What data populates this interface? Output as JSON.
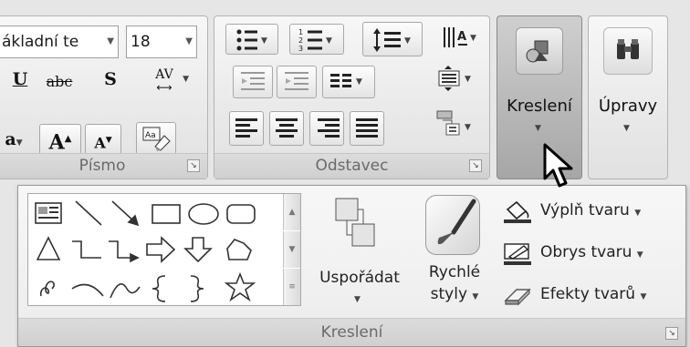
{
  "font_group": {
    "font_name": "ákladní te",
    "font_size": "18",
    "label": "Písmo",
    "underline": "U",
    "strike": "abc",
    "shadow": "S",
    "spacing": "AV",
    "grow": "A",
    "shrink": "A",
    "partial_a": "a"
  },
  "paragraph_group": {
    "label": "Odstavec"
  },
  "drawing_group": {
    "label": "Kreslení"
  },
  "editing_group": {
    "label": "Úpravy"
  },
  "drawing_panel": {
    "arrange": "Uspořádat",
    "quick_styles_line1": "Rychlé",
    "quick_styles_line2": "styly",
    "shape_fill": "Výplň tvaru",
    "shape_outline": "Obrys tvaru",
    "shape_effects": "Efekty tvarů",
    "label": "Kreslení"
  },
  "icons": [
    "bullets-icon",
    "numbering-icon",
    "line-spacing-icon",
    "text-direction-icon",
    "decrease-indent-icon",
    "increase-indent-icon",
    "columns-icon",
    "align-text-icon",
    "align-left-icon",
    "align-center-icon",
    "align-right-icon",
    "justify-icon",
    "smartart-icon",
    "shapes-icon",
    "binoculars-icon",
    "mouse-pointer-icon",
    "paint-bucket-icon",
    "pencil-outline-icon",
    "eraser-effects-icon",
    "star-shape-icon"
  ]
}
